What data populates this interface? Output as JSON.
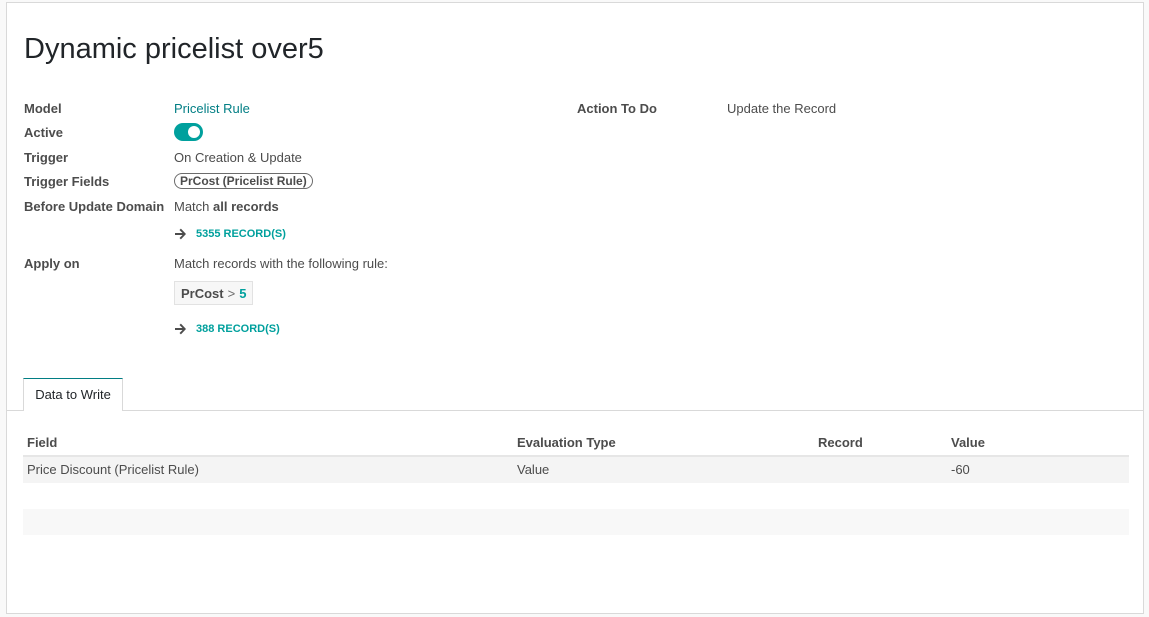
{
  "title": "Dynamic pricelist over5",
  "fields": {
    "model_label": "Model",
    "model_value": "Pricelist Rule",
    "active_label": "Active",
    "trigger_label": "Trigger",
    "trigger_value": "On Creation & Update",
    "trigger_fields_label": "Trigger Fields",
    "trigger_fields_tag": "PrCost (Pricelist Rule)",
    "before_domain_label": "Before Update Domain",
    "before_domain_prefix": "Match ",
    "before_domain_strong": "all records",
    "before_domain_count": "5355 RECORD(S)",
    "apply_on_label": "Apply on",
    "apply_on_text": "Match records with the following rule:",
    "rule_field": "PrCost",
    "rule_operator": ">",
    "rule_value": "5",
    "apply_on_count": "388 RECORD(S)",
    "action_label": "Action To Do",
    "action_value": "Update the Record"
  },
  "toggle": {
    "active": true,
    "color": "#00a09d"
  },
  "tabs": [
    {
      "label": "Data to Write",
      "active": true
    }
  ],
  "table": {
    "columns": [
      "Field",
      "Evaluation Type",
      "Record",
      "Value"
    ],
    "rows": [
      {
        "field": "Price Discount (Pricelist Rule)",
        "evaluation_type": "Value",
        "record": "",
        "value": "-60"
      }
    ]
  },
  "colors": {
    "link": "#017e84",
    "accent": "#00a09d"
  }
}
